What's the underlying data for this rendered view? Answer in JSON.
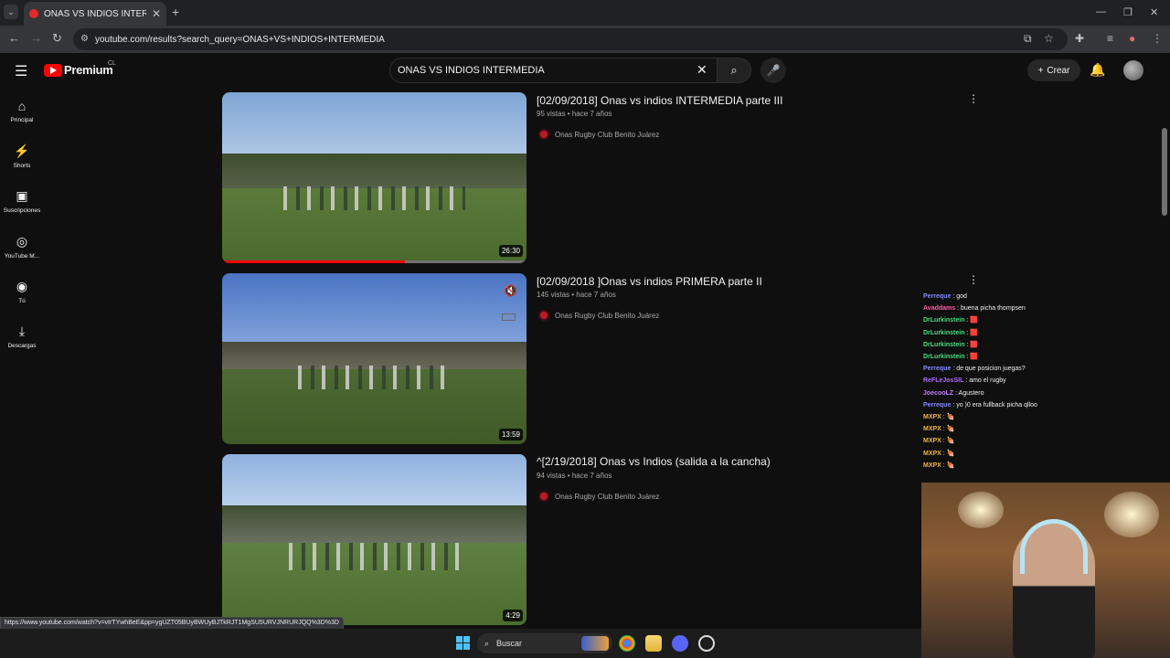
{
  "browser": {
    "tab_title": "ONAS VS INDIOS INTERMEDIA",
    "url": "youtube.com/results?search_query=ONAS+VS+INDIOS+INTERMEDIA"
  },
  "youtube": {
    "brand": "Premium",
    "country": "CL",
    "search_value": "ONAS VS INDIOS INTERMEDIA",
    "create_label": "Crear"
  },
  "sidebar": {
    "items": [
      {
        "label": "Principal",
        "icon": "home-icon"
      },
      {
        "label": "Shorts",
        "icon": "shorts-icon"
      },
      {
        "label": "Suscripciones",
        "icon": "subscriptions-icon"
      },
      {
        "label": "YouTube M...",
        "icon": "youtube-music-icon"
      },
      {
        "label": "Tú",
        "icon": "you-icon"
      },
      {
        "label": "Descargas",
        "icon": "download-icon"
      }
    ]
  },
  "results": [
    {
      "title": "[02/09/2018] Onas vs indios INTERMEDIA parte III",
      "meta": "95 vistas • hace 7 años",
      "channel": "Onas Rugby Club Benito Juárez",
      "duration": "26:30",
      "watched_fraction": 0.6
    },
    {
      "title": "[02/09/2018 ]Onas vs indios PRIMERA parte II",
      "meta": "145 vistas • hace 7 años",
      "channel": "Onas Rugby Club Benito Juárez",
      "duration": "13:59"
    },
    {
      "title": "^[2/19/2018] Onas vs Indios (salida a la cancha)",
      "meta": "94 vistas • hace 7 años",
      "channel": "Onas Rugby Club Benito Juárez",
      "duration": "4:29"
    }
  ],
  "chat": [
    {
      "user": "Perreque",
      "color": "#8a8aff",
      "msg": ": god"
    },
    {
      "user": "Avaddams",
      "color": "#ff5fa2",
      "msg": ": buena picha thompsen"
    },
    {
      "user": "DrLurkinstein",
      "color": "#4ade80",
      "msg": ": 🟥"
    },
    {
      "user": "DrLurkinstein",
      "color": "#4ade80",
      "msg": ": 🟥"
    },
    {
      "user": "DrLurkinstein",
      "color": "#4ade80",
      "msg": ": 🟥"
    },
    {
      "user": "DrLurkinstein",
      "color": "#4ade80",
      "msg": ": 🟥"
    },
    {
      "user": "Perreque",
      "color": "#8a8aff",
      "msg": ": de que posicion juegas?"
    },
    {
      "user": "ReFLeJosSIL",
      "color": "#b06bff",
      "msg": ": amo el rugby"
    },
    {
      "user": "JoecooLZ",
      "color": "#c77dff",
      "msg": ": Agustero"
    },
    {
      "user": "Perreque",
      "color": "#8a8aff",
      "msg": ": yo )0 era fullback picha qlloo"
    },
    {
      "user": "MXPX",
      "color": "#f5b342",
      "msg": ": 🍖"
    },
    {
      "user": "MXPX",
      "color": "#f5b342",
      "msg": ": 🍖"
    },
    {
      "user": "MXPX",
      "color": "#f5b342",
      "msg": ": 🍖"
    },
    {
      "user": "MXPX",
      "color": "#f5b342",
      "msg": ": 🍖"
    },
    {
      "user": "MXPX",
      "color": "#f5b342",
      "msg": ": 🍖"
    }
  ],
  "status_url": "https://www.youtube.com/watch?v=vIrTYwhBeE&pp=ygUZT05BUyBWUyBJTkRJT1MgSU5URVJNRURJQQ%3D%3D",
  "taskbar": {
    "search_label": "Buscar"
  }
}
